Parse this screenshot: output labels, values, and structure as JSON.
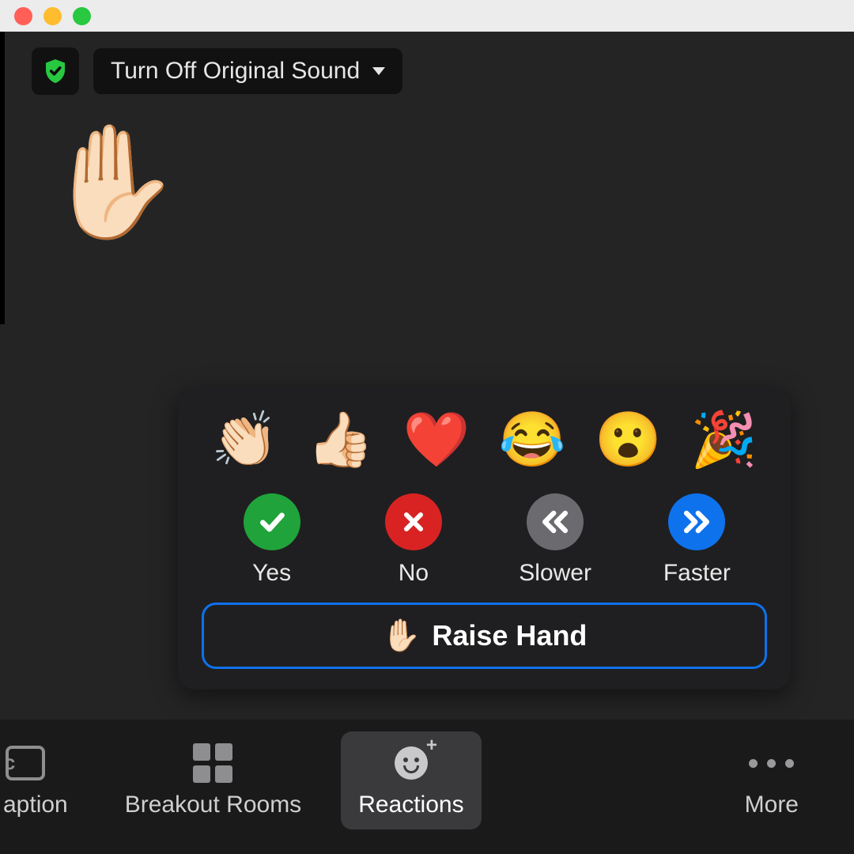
{
  "topbar": {
    "sound_toggle_label": "Turn Off Original Sound"
  },
  "overlay": {
    "raised_hand_emoji": "✋🏻"
  },
  "reactions": {
    "emojis": {
      "clap": "👏🏻",
      "thumbs_up": "👍🏻",
      "heart": "❤️",
      "joy": "😂",
      "open_mouth": "😮",
      "tada": "🎉"
    },
    "feedback": {
      "yes_label": "Yes",
      "no_label": "No",
      "slower_label": "Slower",
      "faster_label": "Faster"
    },
    "raise_hand": {
      "emoji": "✋🏻",
      "label": "Raise Hand"
    }
  },
  "toolbar": {
    "caption_label": "aption",
    "breakout_label": "Breakout Rooms",
    "reactions_label": "Reactions",
    "more_label": "More"
  },
  "colors": {
    "accent_blue": "#0e72ed",
    "green": "#1fa33a",
    "red": "#d92323",
    "gray": "#6a6a6f"
  }
}
